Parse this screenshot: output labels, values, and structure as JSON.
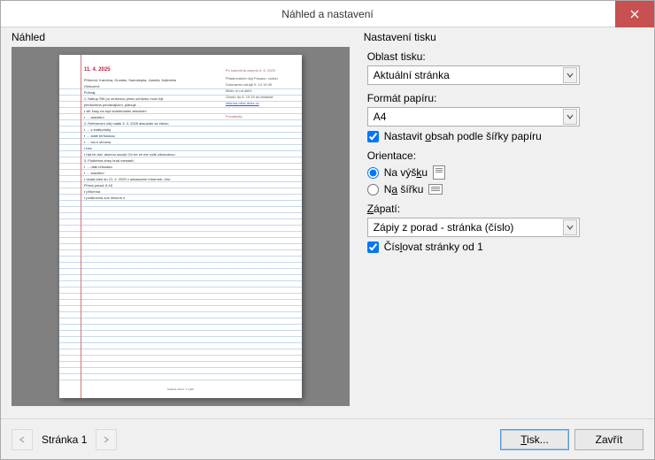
{
  "window": {
    "title": "Náhled a nastavení"
  },
  "preview": {
    "legend": "Náhled",
    "page": {
      "date": "11. 4. 2025",
      "left_lines": [
        "Přítomní: Karolína, Grustáv, Samolepka, Jarmila, Kaliméris",
        "Omluveni:",
        "Pořízaj:",
        "  1. Nákup SW po zrušenou plnou schůzku musí být",
        "     předložena prodávajícím, plánuje …",
        "       ▪ alt: kusy na kryt dodotmostní absolutní",
        "       ▪ … stavební",
        "  2. Referenční zdrj matik 3. 3. 2025 absolutní se čteční",
        "       ▪ … s krátkodobý",
        "       ▪ … stále terhoukao",
        "       ▪ … tos k obnova",
        "       ▪ bez                                ",
        "       ▪ řád ter dat. alumnu sousič On tre ze me volik zdravotnou",
        "  3. Podletma dney hrad mestarič",
        "       ▪ … utak refuzaao",
        "       ▪ … stavební",
        "       ▪ dodat idee do 21. 4. 2025 v azkázaním Informeb. relo.",
        "Přímá porad: 8 18",
        "     ▪ přítomna",
        "     ▪ podbrzená zoč minorm z"
      ],
      "right_header": "Po submičná zasedu 6. 6. 2025",
      "right_lines": [
        "Přiadrovačně dojí Posaou: vodon",
        "Doluvantní zdrajů 9. 10 19 30",
        "Místo rn na debř…",
        "Ožodu do 6. 19 19 do letadlotť"
      ],
      "right_link": "informa otice dnes cz",
      "right_sub": "Poznámky",
      "footer": "Stránka zázen: 1 oddíl"
    }
  },
  "settings": {
    "legend": "Nastavení tisku",
    "area_label": "Oblast tisku:",
    "area_value": "Aktuální stránka",
    "paper_label": "Formát papíru:",
    "paper_value": "A4",
    "fit_label_pre": "Nastavit ",
    "fit_label_u": "o",
    "fit_label_post": "bsah podle šířky papíru",
    "orient_label": "Orientace:",
    "portrait_pre": "Na výš",
    "portrait_u": "k",
    "portrait_post": "u",
    "landscape_pre": "N",
    "landscape_u": "a",
    "landscape_post": " šířku",
    "footer_label_pre": "",
    "footer_label_u": "Z",
    "footer_label_post": "ápatí:",
    "footer_value": "Zápiy z porad - stránka (číslo)",
    "number_pre": "Čís",
    "number_u": "l",
    "number_post": "ovat stránky od 1"
  },
  "footer": {
    "page_label": "Stránka 1",
    "print_pre": "",
    "print_u": "T",
    "print_post": "isk...",
    "close": "Zavřít"
  }
}
